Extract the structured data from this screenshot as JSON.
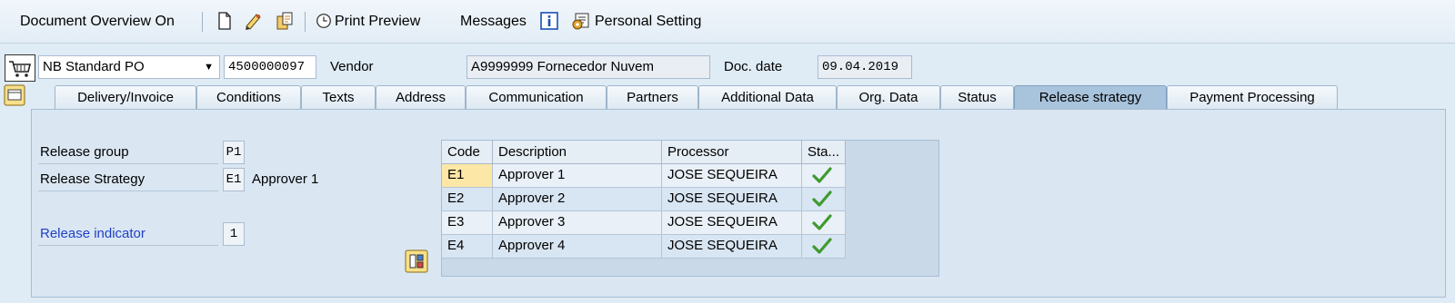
{
  "toolbar": {
    "doc_overview": "Document Overview On",
    "print_preview": "Print Preview",
    "messages": "Messages",
    "personal_setting": "Personal Setting"
  },
  "header": {
    "doc_type": "NB Standard PO",
    "po_number": "4500000097",
    "vendor_label": "Vendor",
    "vendor_value": "A9999999 Fornecedor Nuvem",
    "doc_date_label": "Doc. date",
    "doc_date_value": "09.04.2019"
  },
  "tabs": [
    {
      "label": "Delivery/Invoice"
    },
    {
      "label": "Conditions"
    },
    {
      "label": "Texts"
    },
    {
      "label": "Address"
    },
    {
      "label": "Communication"
    },
    {
      "label": "Partners"
    },
    {
      "label": "Additional Data"
    },
    {
      "label": "Org. Data"
    },
    {
      "label": "Status"
    },
    {
      "label": "Release strategy",
      "active": true
    },
    {
      "label": "Payment Processing"
    }
  ],
  "release": {
    "group_label": "Release group",
    "group_value": "P1",
    "strategy_label": "Release Strategy",
    "strategy_value": "E1",
    "strategy_text": "Approver 1",
    "indicator_label": "Release indicator",
    "indicator_value": "1"
  },
  "table": {
    "columns": [
      "Code",
      "Description",
      "Processor",
      "Sta..."
    ],
    "rows": [
      {
        "code": "E1",
        "description": "Approver 1",
        "processor": "JOSE SEQUEIRA",
        "status": "released-check-icon"
      },
      {
        "code": "E2",
        "description": "Approver 2",
        "processor": "JOSE SEQUEIRA",
        "status": "released-check-icon"
      },
      {
        "code": "E3",
        "description": "Approver 3",
        "processor": "JOSE SEQUEIRA",
        "status": "released-check-icon"
      },
      {
        "code": "E4",
        "description": "Approver 4",
        "processor": "JOSE SEQUEIRA",
        "status": "released-check-icon"
      }
    ]
  },
  "colors": {
    "accent_link": "#1f3fc4",
    "check_green": "#3f9a2f",
    "active_tab": "#a8c3dc",
    "selected_cell": "#fde7a6"
  }
}
